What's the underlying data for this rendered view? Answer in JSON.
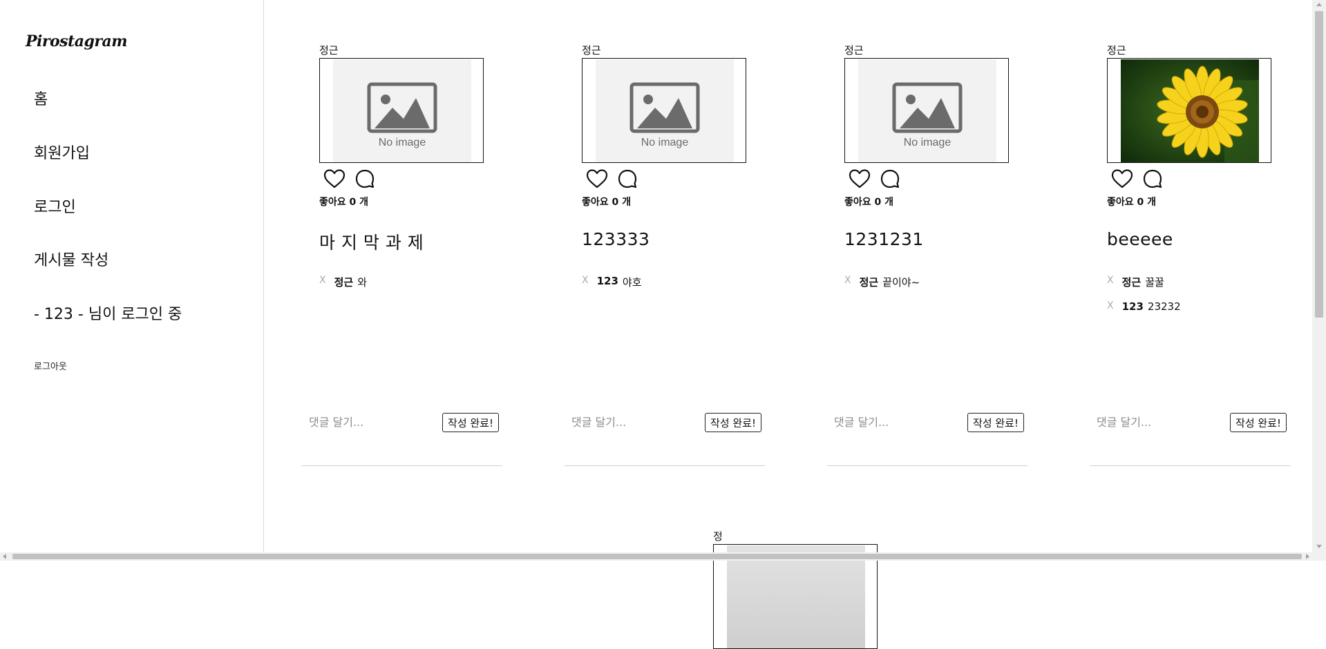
{
  "brand": {
    "name": "Pirostagram"
  },
  "nav": {
    "home": "홈",
    "signup": "회원가입",
    "login": "로그인",
    "write": "게시물 작성",
    "status": "- 123 - 님이 로그인 중",
    "logout": "로그아웃"
  },
  "placeholders": {
    "no_image": "No image"
  },
  "posts": [
    {
      "author": "정근",
      "image": "no-image-placeholder",
      "likes_label": "좋아요",
      "likes_count": "0",
      "likes_unit": "개",
      "caption": "마 지 막 과 제",
      "comments": [
        {
          "delete": "X",
          "user": "정근",
          "text": "와"
        }
      ],
      "comment_placeholder": "댓글 달기...",
      "submit_label": "작성 완료!"
    },
    {
      "author": "정근",
      "image": "no-image-placeholder",
      "likes_label": "좋아요",
      "likes_count": "0",
      "likes_unit": "개",
      "caption": "123333",
      "comments": [
        {
          "delete": "X",
          "user": "123",
          "text": "야호"
        }
      ],
      "comment_placeholder": "댓글 달기...",
      "submit_label": "작성 완료!"
    },
    {
      "author": "정근",
      "image": "no-image-placeholder",
      "likes_label": "좋아요",
      "likes_count": "0",
      "likes_unit": "개",
      "caption": "1231231",
      "comments": [
        {
          "delete": "X",
          "user": "정근",
          "text": "끝이야~"
        }
      ],
      "comment_placeholder": "댓글 달기...",
      "submit_label": "작성 완료!"
    },
    {
      "author": "정근",
      "image": "sunflower-photo",
      "likes_label": "좋아요",
      "likes_count": "0",
      "likes_unit": "개",
      "caption": "beeeee",
      "comments": [
        {
          "delete": "X",
          "user": "정근",
          "text": "꿀꿀"
        },
        {
          "delete": "X",
          "user": "123",
          "text": "23232"
        }
      ],
      "comment_placeholder": "댓글 달기...",
      "submit_label": "작성 완료!"
    },
    {
      "author": "정근",
      "image": "photo-partially-visible"
    }
  ],
  "colors": {
    "divider": "#dbdbdb",
    "placeholder_bg": "#f2f2f2",
    "icon_gray": "#6b6b6b"
  }
}
